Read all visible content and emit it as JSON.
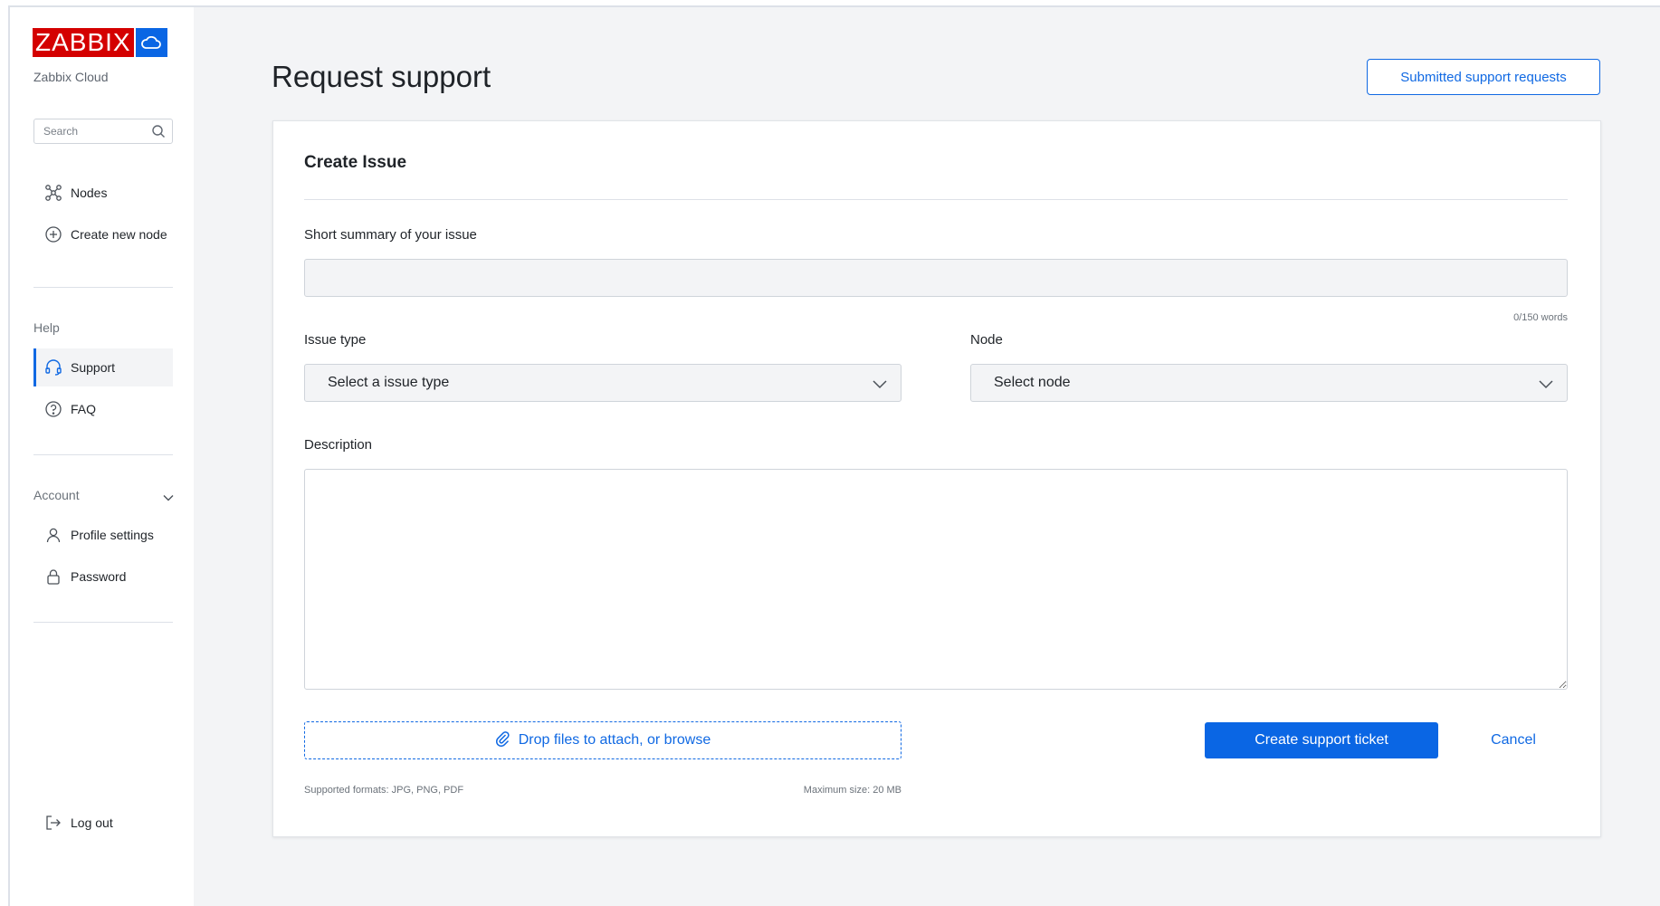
{
  "brand": {
    "logo_text": "ZABBIX",
    "subtitle": "Zabbix Cloud",
    "red": "#d40000",
    "blue": "#0a66e4"
  },
  "sidebar": {
    "search_placeholder": "Search",
    "items_top": [
      {
        "label": "Nodes",
        "icon": "nodes-icon"
      },
      {
        "label": "Create new node",
        "icon": "plus-circle-icon"
      }
    ],
    "help_label": "Help",
    "items_help": [
      {
        "label": "Support",
        "icon": "headset-icon",
        "active": true
      },
      {
        "label": "FAQ",
        "icon": "question-circle-icon"
      }
    ],
    "account_label": "Account",
    "items_account": [
      {
        "label": "Profile settings",
        "icon": "user-icon"
      },
      {
        "label": "Password",
        "icon": "lock-icon"
      }
    ],
    "logout_label": "Log out"
  },
  "header": {
    "title": "Request support",
    "submitted_button": "Submitted support requests"
  },
  "form": {
    "title": "Create Issue",
    "summary_label": "Short summary of your issue",
    "summary_value": "",
    "word_counter": "0/150 words",
    "issue_type_label": "Issue type",
    "issue_type_value": "Select a issue type",
    "node_label": "Node",
    "node_value": "Select node",
    "description_label": "Description",
    "description_value": "",
    "dropzone_text": "Drop files to attach, or browse",
    "formats_text": "Supported formats: JPG, PNG, PDF",
    "max_size_text": "Maximum size: 20 MB",
    "submit_label": "Create support ticket",
    "cancel_label": "Cancel"
  },
  "colors": {
    "accent": "#1069e3",
    "background": "#f3f4f6"
  }
}
